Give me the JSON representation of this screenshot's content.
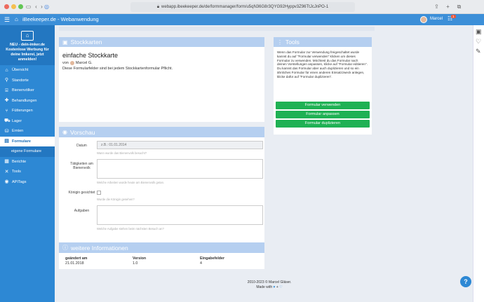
{
  "browser": {
    "url": "webapp.ibeekeeper.de/de/formmanager/form/u5qN36G8r3QYG92Hyppv3Z96TtJcJnPO-1"
  },
  "app": {
    "title": "iBeekeeper.de - Webanwendung",
    "user_name": "Marcel",
    "notifications": "1"
  },
  "sidebar": {
    "promo": "NEU - dein-imker.de Kostenlose Werbung für deine Imkerei, jetzt anmelden!",
    "items": [
      {
        "label": "Übersicht",
        "icon": "home-icon"
      },
      {
        "label": "Standorte",
        "icon": "location-pin-icon"
      },
      {
        "label": "Bienenvölker",
        "icon": "hive-icon"
      },
      {
        "label": "Behandlungen",
        "icon": "treatment-icon"
      },
      {
        "label": "Fütterungen",
        "icon": "feeding-icon"
      },
      {
        "label": "Lager",
        "icon": "truck-icon"
      },
      {
        "label": "Ernten",
        "icon": "harvest-icon"
      },
      {
        "label": "Formulare",
        "icon": "form-icon",
        "active": true
      },
      {
        "label": "eigene Formulare",
        "icon": "",
        "sub": true
      },
      {
        "label": "Berichte",
        "icon": "report-icon"
      },
      {
        "label": "Tools",
        "icon": "tools-icon"
      },
      {
        "label": "APITags",
        "icon": "api-icon"
      }
    ]
  },
  "stockkarten": {
    "header": "Stockkarten",
    "title": "einfache Stockkarte",
    "by_prefix": "von",
    "author": "Marcel G.",
    "note": "Diese Formularfelder sind bei jedem Stockkartenformular Pflicht."
  },
  "tools": {
    "header": "Tools",
    "description": "Wenn das Formular zur Verwendung freigeschaltet wurde kannst du auf \"Formular verwenden\" klicken um dieses Formular zu verwenden. Möchtest du das Formular nach deinen Vorstellungen anpassen, klicke auf \"Formular editieren\". Du kannst das Formular aber auch duplizieren und so ein ähnliches Formular für einen anderen Einsatzzweck anlegen, klicke dafür auf \"Formular duplizieren\".",
    "btn_use": "Formular verwenden",
    "btn_adapt": "Formular anpassen",
    "btn_duplicate": "Formular duplizieren"
  },
  "preview": {
    "header": "Vorschau",
    "date_label": "Datum",
    "date_placeholder": "z.B.: 01.01.2014",
    "date_help": "Wann wurde das Bienenvolk besucht?",
    "activities_label": "Tätigkeiten am Bienenvolk",
    "activities_help": "Welche Arbeiten wurde heute am Bienenvolk getan.",
    "queen_label": "Königin gesichtet",
    "queen_help": "Wurde die Königin gesehen?",
    "tasks_label": "Aufgaben",
    "tasks_help": "Welche Aufgabe stehen beim nächsten Besuch an?"
  },
  "info": {
    "header": "weitere Informationen",
    "col1_label": "geändert am",
    "col1_value": "21.01.2018",
    "col2_label": "Version",
    "col2_value": "1.0",
    "col3_label": "Eingabefelder",
    "col3_value": "4"
  },
  "footer": {
    "line1": "2010-2023 © Marcel Gläser.",
    "line2": "Made with"
  },
  "colors": {
    "primary": "#2d88d4",
    "button_green": "#1fb154",
    "panel_header": "#b5cff0"
  }
}
